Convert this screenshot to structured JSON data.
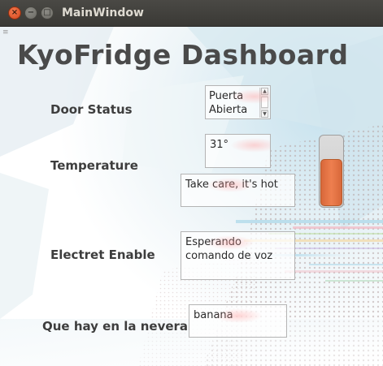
{
  "window": {
    "title": "MainWindow",
    "close_glyph": "×",
    "minimize_glyph": "−",
    "maximize_glyph": "□"
  },
  "dashboard": {
    "title": "KyoFridge Dashboard"
  },
  "door": {
    "label": "Door Status",
    "value_line1": "Puerta",
    "value_line2": "Abierta"
  },
  "temperature": {
    "label": "Temperature",
    "value": "31°",
    "message": "Take care, it's hot",
    "level_fraction": 0.68,
    "bar_color": "#ee7f4f"
  },
  "electret": {
    "label": "Electret Enable",
    "status": "Esperando comando de voz"
  },
  "nevera": {
    "label": "Que hay en la nevera",
    "content": "banana"
  },
  "icons": {
    "close": "close-icon",
    "minimize": "minimize-icon",
    "maximize": "maximize-icon",
    "scroll_up": "scroll-up-arrow-icon",
    "scroll_down": "scroll-down-arrow-icon"
  }
}
